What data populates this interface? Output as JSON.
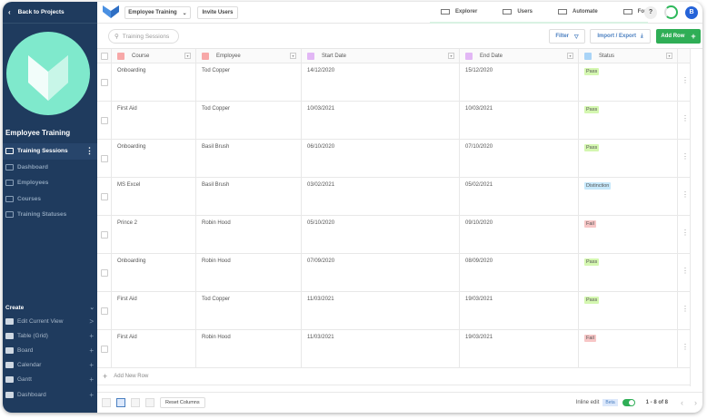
{
  "sidebar": {
    "back": "Back to Projects",
    "project": "Employee Training",
    "items": [
      {
        "label": "Training Sessions"
      },
      {
        "label": "Dashboard"
      },
      {
        "label": "Employees"
      },
      {
        "label": "Courses"
      },
      {
        "label": "Training Statuses"
      }
    ],
    "create": {
      "title": "Create",
      "items": [
        {
          "label": "Edit Current View",
          "action": ">"
        },
        {
          "label": "Table (Grid)",
          "action": "+"
        },
        {
          "label": "Board",
          "action": "+"
        },
        {
          "label": "Calendar",
          "action": "+"
        },
        {
          "label": "Gantt",
          "action": "+"
        },
        {
          "label": "Dashboard",
          "action": "+"
        }
      ]
    }
  },
  "top": {
    "project_select": "Employee Training",
    "invite": "Invite Users",
    "tabs": [
      "Explorer",
      "Users",
      "Automate",
      "Forms"
    ],
    "help": "?",
    "avatar": "B"
  },
  "toolbar": {
    "search_placeholder": "Training Sessions",
    "filter": "Filter",
    "import_export": "Import / Export",
    "add_row": "Add Row"
  },
  "table": {
    "columns": [
      "Course",
      "Employee",
      "Start Date",
      "End Date",
      "Status"
    ],
    "rows": [
      [
        "Onboarding",
        "Tod Copper",
        "14/12/2020",
        "15/12/2020",
        "Pass"
      ],
      [
        "First Aid",
        "Tod Copper",
        "10/03/2021",
        "10/03/2021",
        "Pass"
      ],
      [
        "Onboarding",
        "Basil Brush",
        "06/10/2020",
        "07/10/2020",
        "Pass"
      ],
      [
        "MS Excel",
        "Basil Brush",
        "03/02/2021",
        "05/02/2021",
        "Distinction"
      ],
      [
        "Prince 2",
        "Robin Hood",
        "05/10/2020",
        "09/10/2020",
        "Fail"
      ],
      [
        "Onboarding",
        "Robin Hood",
        "07/09/2020",
        "08/09/2020",
        "Pass"
      ],
      [
        "First Aid",
        "Tod Copper",
        "11/03/2021",
        "19/03/2021",
        "Pass"
      ],
      [
        "First Aid",
        "Robin Hood",
        "11/03/2021",
        "19/03/2021",
        "Fail"
      ]
    ],
    "add_new_row": "Add New Row"
  },
  "status_colors": {
    "Pass": "#d4f7b0",
    "Fail": "#f7c6c6",
    "Distinction": "#c6e8fb"
  },
  "footer": {
    "reset_columns": "Reset Columns",
    "inline_edit": "Inline edit",
    "beta": "Beta",
    "pagination": "1 - 8 of 8"
  }
}
